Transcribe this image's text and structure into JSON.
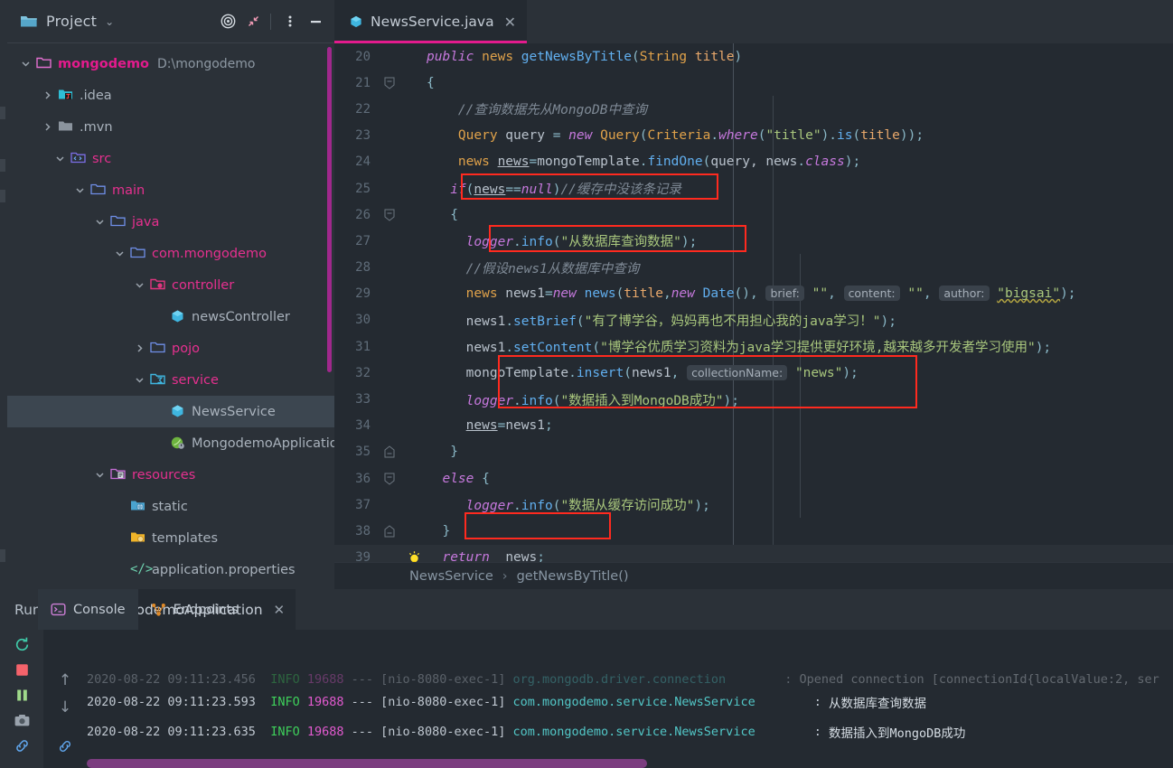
{
  "project_panel": {
    "title": "Project",
    "chevron": "⌄",
    "icons": [
      "target-icon",
      "collapse-all-icon",
      "more-options-icon",
      "minimize-icon"
    ],
    "tree": [
      {
        "label": "mongodemo",
        "path": "D:\\mongodemo",
        "arrow": "expanded",
        "icon": "module-folder-icon",
        "indent": 0,
        "style": "magenta-bold",
        "selected": false
      },
      {
        "label": ".idea",
        "path": "",
        "arrow": "collapsed",
        "icon": "idea-folder-icon",
        "indent": 1,
        "style": "gray",
        "selected": false
      },
      {
        "label": ".mvn",
        "path": "",
        "arrow": "collapsed",
        "icon": "folder-icon",
        "indent": 1,
        "style": "gray",
        "selected": false
      },
      {
        "label": "src",
        "path": "",
        "arrow": "expanded",
        "icon": "sources-root-icon",
        "indent": 1,
        "style": "pink",
        "selected": false
      },
      {
        "label": "main",
        "path": "",
        "arrow": "expanded",
        "icon": "folder-blue-icon",
        "indent": 2,
        "style": "pink",
        "selected": false
      },
      {
        "label": "java",
        "path": "",
        "arrow": "expanded",
        "icon": "folder-blue-icon",
        "indent": 3,
        "style": "pink",
        "selected": false
      },
      {
        "label": "com.mongodemo",
        "path": "",
        "arrow": "expanded",
        "icon": "package-icon",
        "indent": 4,
        "style": "pink",
        "selected": false
      },
      {
        "label": "controller",
        "path": "",
        "arrow": "expanded",
        "icon": "controller-package-icon",
        "indent": 5,
        "style": "pink",
        "selected": false
      },
      {
        "label": "newsController",
        "path": "",
        "arrow": "none",
        "icon": "java-class-icon",
        "indent": 6,
        "style": "gray",
        "selected": false
      },
      {
        "label": "pojo",
        "path": "",
        "arrow": "collapsed",
        "icon": "package-icon",
        "indent": 5,
        "style": "pink",
        "selected": false
      },
      {
        "label": "service",
        "path": "",
        "arrow": "expanded",
        "icon": "service-package-icon",
        "indent": 5,
        "style": "pink",
        "selected": false
      },
      {
        "label": "NewsService",
        "path": "",
        "arrow": "none",
        "icon": "java-class-icon",
        "indent": 6,
        "style": "gray",
        "selected": true
      },
      {
        "label": "MongodemoApplication",
        "path": "",
        "arrow": "none",
        "icon": "spring-boot-icon",
        "indent": 6,
        "style": "gray",
        "selected": false
      },
      {
        "label": "resources",
        "path": "",
        "arrow": "expanded",
        "icon": "resources-root-icon",
        "indent": 3,
        "style": "pink",
        "selected": false
      },
      {
        "label": "static",
        "path": "",
        "arrow": "none",
        "icon": "static-folder-icon",
        "indent": 4,
        "style": "gray",
        "selected": false
      },
      {
        "label": "templates",
        "path": "",
        "arrow": "none",
        "icon": "templates-folder-icon",
        "indent": 4,
        "style": "gray",
        "selected": false
      },
      {
        "label": "application.properties",
        "path": "",
        "arrow": "none",
        "icon": "properties-file-icon",
        "indent": 4,
        "style": "gray",
        "selected": false
      }
    ]
  },
  "editor": {
    "tab": {
      "label": "NewsService.java",
      "icon": "java-class-icon",
      "close": "✕"
    },
    "breadcrumb": {
      "class": "NewsService",
      "separator": "›",
      "method": "getNewsByTitle()"
    },
    "lines": [
      {
        "n": "20"
      },
      {
        "n": "21"
      },
      {
        "n": "22"
      },
      {
        "n": "23"
      },
      {
        "n": "24"
      },
      {
        "n": "25"
      },
      {
        "n": "26"
      },
      {
        "n": "27"
      },
      {
        "n": "28"
      },
      {
        "n": "29"
      },
      {
        "n": "30"
      },
      {
        "n": "31"
      },
      {
        "n": "32"
      },
      {
        "n": "33"
      },
      {
        "n": "34"
      },
      {
        "n": "35"
      },
      {
        "n": "36"
      },
      {
        "n": "37"
      },
      {
        "n": "38"
      },
      {
        "n": "39"
      }
    ],
    "code": {
      "l20": "public news getNewsByTitle(String title)",
      "l21": "{",
      "l22": "//查询数据先从MongoDB中查询",
      "l23": "Query query = new Query(Criteria.where(\"title\").is(title));",
      "l24": "news news=mongoTemplate.findOne(query, news.class);",
      "l25": "if(news==null)//缓存中没该条记录",
      "l26": "{",
      "l27": "logger.info(\"从数据库查询数据\");",
      "l28": "//假设news1从数据库中查询",
      "l29": "news news1=new news(title,new Date(), brief: \"\", content: \"\", author: \"bigsai\");",
      "l30": "news1.setBrief(\"有了博学谷，妈妈再也不用担心我的java学习！\");",
      "l31": "news1.setContent(\"博学谷优质学习资料为java学习提供更好环境,越来越多开发者学习使用\");",
      "l32": "mongoTemplate.insert(news1, collectionName: \"news\");",
      "l33": "logger.info(\"数据插入到MongoDB成功\");",
      "l34": "news=news1;",
      "l35": "}",
      "l36": "else {",
      "l37": "logger.info(\"数据从缓存访问成功\");",
      "l38": "}",
      "l39": "return  news;"
    },
    "tokens": {
      "public": "public",
      "news_type": "news",
      "getNewsByTitle": "getNewsByTitle",
      "String": "String",
      "title": "title",
      "new": "new",
      "Query": "Query",
      "query": "query",
      "Criteria": "Criteria",
      "where": "where",
      "title_str": "\"title\"",
      "is": "is",
      "mongoTemplate": "mongoTemplate",
      "findOne": "findOne",
      "class": "class",
      "if": "if",
      "null": "null",
      "logger": "logger",
      "info": "info",
      "Date": "Date",
      "brief_hint": "brief:",
      "content_hint": "content:",
      "author_hint": "author:",
      "collectionName_hint": "collectionName:",
      "bigsai": "\"bigsai\"",
      "setBrief": "setBrief",
      "setContent": "setContent",
      "insert": "insert",
      "else": "else",
      "return": "return",
      "news1": "news1",
      "news_str": "\"news\"",
      "msg_query_db": "\"从数据库查询数据\"",
      "msg_insert_ok": "\"数据插入到MongoDB成功\"",
      "msg_cache_ok": "\"数据从缓存访问成功\"",
      "cmt22": "//查询数据先从MongoDB中查询",
      "cmt25": "//缓存中没该条记录",
      "cmt28": "//假设news1从数据库中查询",
      "brief_text": "\"有了博学谷，妈妈再也不用担心我的java学习！\"",
      "content_text": "\"博学谷优质学习资料为java学习提供更好环境,越来越多开发者学习使用\""
    }
  },
  "run_panel": {
    "run_label": "Run:",
    "config_name": "MongodemoApplication",
    "config_close": "✕",
    "tabs": [
      {
        "label": "Console",
        "icon": "console-icon",
        "active": true
      },
      {
        "label": "Endpoints",
        "icon": "endpoints-icon",
        "active": false
      }
    ],
    "sidebar_icons": [
      "rerun-icon",
      "stop-icon",
      "pause-icon",
      "screenshot-icon",
      "link-icon"
    ],
    "nav_icons": [
      "scroll-up-icon",
      "scroll-down-icon",
      "link-icon"
    ],
    "logs": [
      {
        "date": "2020-08-22 09:11:23.456",
        "level": "INFO",
        "pid": "19688",
        "dashes": "---",
        "thread": "[nio-8080-exec-1]",
        "logger": "org.mongodb.driver.connection",
        "colon": ":",
        "message": "Opened connection [connectionId{localValue:2, ser"
      },
      {
        "date": "2020-08-22 09:11:23.593",
        "level": "INFO",
        "pid": "19688",
        "dashes": "---",
        "thread": "[nio-8080-exec-1]",
        "logger": "com.mongodemo.service.NewsService",
        "colon": ":",
        "message": "从数据库查询数据"
      },
      {
        "date": "2020-08-22 09:11:23.635",
        "level": "INFO",
        "pid": "19688",
        "dashes": "---",
        "thread": "[nio-8080-exec-1]",
        "logger": "com.mongodemo.service.NewsService",
        "colon": ":",
        "message": "数据插入到MongoDB成功"
      }
    ]
  },
  "colors": {
    "accent": "#e31b8d",
    "panel_bg": "#2b3138",
    "editor_bg": "#242a31",
    "highlight_box": "#ff2a1f",
    "selection": "#3c4650",
    "string": "#a9c77d",
    "keyword": "#c679dd",
    "method": "#61afef",
    "comment": "#7f8a96",
    "log_info": "#3ecf5a",
    "log_pid": "#e35ad0",
    "log_class": "#52c7c7"
  }
}
